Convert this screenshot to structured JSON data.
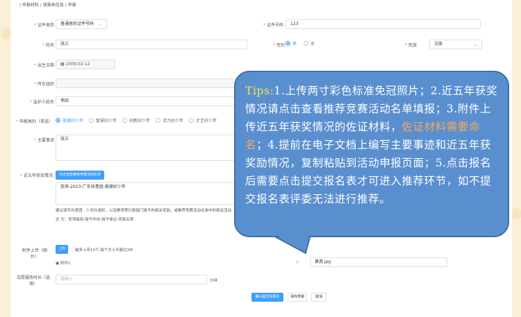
{
  "breadcrumb": "| 申报材料 / 填报表信息 / 申报",
  "form": {
    "id_type": {
      "label": "证件类型",
      "value": "普通居民证件号码"
    },
    "id_number": {
      "label": "证件号码",
      "value": "123"
    },
    "name": {
      "label": "姓名",
      "value": "张三"
    },
    "gender": {
      "label": "性别",
      "options": [
        "男",
        "女"
      ],
      "selected": "男"
    },
    "ethnicity": {
      "label": "民族",
      "value": "汉族"
    },
    "birth": {
      "label": "出生日期",
      "value": "2009-02-12"
    },
    "org": {
      "label": "所在组织",
      "value": ""
    },
    "guardian": {
      "label": "监护人姓名",
      "value": "李四"
    },
    "category": {
      "label": "申报类别（单选）",
      "options": [
        "美德好少年",
        "智慧好少年",
        "创新好少年",
        "活力好少年",
        "才艺好少年"
      ],
      "selected": "美德好少年"
    },
    "deeds": {
      "label": "主要事迹",
      "value": "张三"
    },
    "awards": {
      "label": "近五年获奖情况",
      "button": "点击查看推荐竞赛活动名单",
      "value": "奖项-2023-广东共青团-美德好少年"
    },
    "note1": "建议填写共青团、少先队组织，以及教育等行政部门授予的相关奖励，或推荐竞赛活动名单中的相关活动",
    "note2": "式 为：奖项级别-授予年份-授予单位-奖励名称",
    "attachment": {
      "label": "附件上传（图片）",
      "upload_btn": "上传",
      "hint": "最多上传10个,每个大小不超过2M",
      "file": "附件1"
    },
    "right_file": "黄真.jpg",
    "hours": {
      "label": "志愿服务时长（选填）",
      "placeholder": "请输入",
      "unit": "分钟"
    }
  },
  "actions": {
    "submit": "确认提交并报名",
    "save": "保存草稿",
    "cancel": "取消"
  },
  "tooltip": {
    "tips_label": "Tips:",
    "part1": "1.上传两寸彩色标准免冠照片；2.近五年获奖情况请点击查看推荐竞赛活动名单填报；3.附件上传近五年获奖情况的佐证材料，",
    "highlight": "佐证材料需要命名",
    "part2": "；4.提前在电子文档上编写主要事迹和近五年获奖励情况，复制粘贴到活动申报页面；5.点击报名后需要点击提交报名表才可进入推荐环节，如不提交报名表评委无法进行推荐。"
  },
  "colors": {
    "accent": "#409eff",
    "bubble": "#5a8fcf",
    "tips": "#f2ea3c",
    "highlight": "#f6a95a",
    "background": "#fbefd6"
  }
}
